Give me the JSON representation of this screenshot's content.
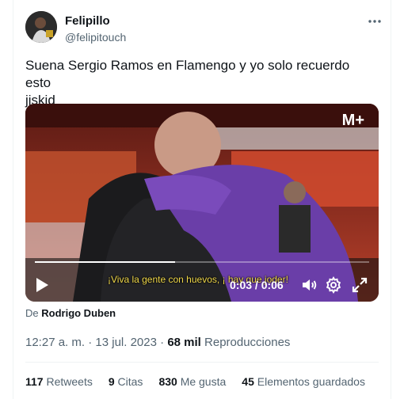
{
  "author": {
    "name": "Felipillo",
    "handle": "@felipitouch"
  },
  "tweet": {
    "line1": "Suena Sergio Ramos en Flamengo y yo solo recuerdo esto",
    "line2": "jjskjd"
  },
  "video": {
    "brand": "M+",
    "subtitle": "¡Viva la gente con huevos, ¡ hay que joder!",
    "time": "0:03 / 0:06",
    "progress": 0.42
  },
  "attribution": {
    "label": "De",
    "name": "Rodrigo Duben"
  },
  "meta": {
    "time": "12:27 a. m.",
    "sep": "·",
    "date": "13 jul. 2023",
    "views_count": "68 mil",
    "views_label": "Reproducciones"
  },
  "stats": [
    {
      "count": "117",
      "label": "Retweets"
    },
    {
      "count": "9",
      "label": "Citas"
    },
    {
      "count": "830",
      "label": "Me gusta"
    },
    {
      "count": "45",
      "label": "Elementos guardados"
    }
  ],
  "icons": {
    "more": "more-dots-icon",
    "play": "play-icon",
    "volume": "volume-icon",
    "settings": "settings-gear-icon",
    "fullscreen": "fullscreen-icon"
  }
}
